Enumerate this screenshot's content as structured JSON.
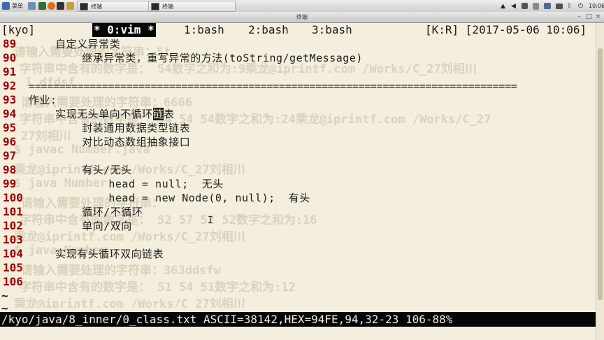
{
  "panel": {
    "menu_label": "菜单",
    "tasks": [
      {
        "label": "终端"
      },
      {
        "label": "终端"
      }
    ],
    "clock": "10:06"
  },
  "window": {
    "title": "终端"
  },
  "tmux": {
    "session": "[kyo]",
    "windows": [
      {
        "label": "* 0:vim *",
        "active": true
      },
      {
        "label": "1:bash",
        "active": false
      },
      {
        "label": "2:bash",
        "active": false
      },
      {
        "label": "3:bash",
        "active": false
      }
    ],
    "right_status": "[K:R] [2017-05-06 10:06]"
  },
  "editor": {
    "lines": [
      {
        "num": "89",
        "text": "    自定义异常类"
      },
      {
        "num": "90",
        "text": "        继承异常类，重写异常的方法(toString/getMessage)"
      },
      {
        "num": "91",
        "text": ""
      },
      {
        "num": "92",
        "text": "================================================================================"
      },
      {
        "num": "93",
        "text": "作业:"
      },
      {
        "num": "94",
        "text_before": "    实现无头单向不循环",
        "cursor": "链",
        "text_after": "表"
      },
      {
        "num": "95",
        "text": "        封装通用数据类型链表"
      },
      {
        "num": "96",
        "text": "        对比动态数组抽象接口"
      },
      {
        "num": "97",
        "text": ""
      },
      {
        "num": "98",
        "text": "        有头/无头"
      },
      {
        "num": "99",
        "text": "            head = null;  无头"
      },
      {
        "num": "100",
        "text": "            head = new Node(0, null);  有头"
      },
      {
        "num": "101",
        "text": "        循环/不循环"
      },
      {
        "num": "102",
        "text": "        单向/双向"
      },
      {
        "num": "103",
        "text": ""
      },
      {
        "num": "104",
        "text": "    实现有头循环双向链表"
      },
      {
        "num": "105",
        "text": ""
      },
      {
        "num": "106",
        "text": ""
      }
    ],
    "tildes": [
      "~",
      "~"
    ],
    "ghost_lines": [
      "请输入需要处理的字符串：5t",
      "字符串中含有的数字是： 54数字之和为:9乘龙@iprintf.com /Works/C_27刘相川",
      "1 dfdsf",
      "请输入需要处理的字符串：6666",
      "字符串中含有的数字是： 54 54 54数字之和为:24乘龙@iprintf.com /Works/C_27",
      "27刘相川",
      "$ javac Number.java",
      "乘龙@iprintf.com /Works/C_27刘相川",
      "$ java Number",
      "请输入需要处理的字符串：",
      "字符串中含有的数字是： 52 57 52 52数字之和为:16",
      "乘龙@iprintf.com /Works/C_27刘相川",
      "$ java Number",
      "请输入需要处理的字符串：363ddsfw",
      "字符串中含有的数字是： 51 54 51数字之和为:12",
      "乘龙@iprintf.com /Works/C_27刘相川"
    ]
  },
  "statusline": {
    "text": "/kyo/java/8_inner/0_class.txt ASCII=38142,HEX=94FE,94,32-23 106-88%"
  },
  "colors": {
    "background": "#f4efdc",
    "line_number": "#9b0000",
    "status_bg": "#050505"
  }
}
